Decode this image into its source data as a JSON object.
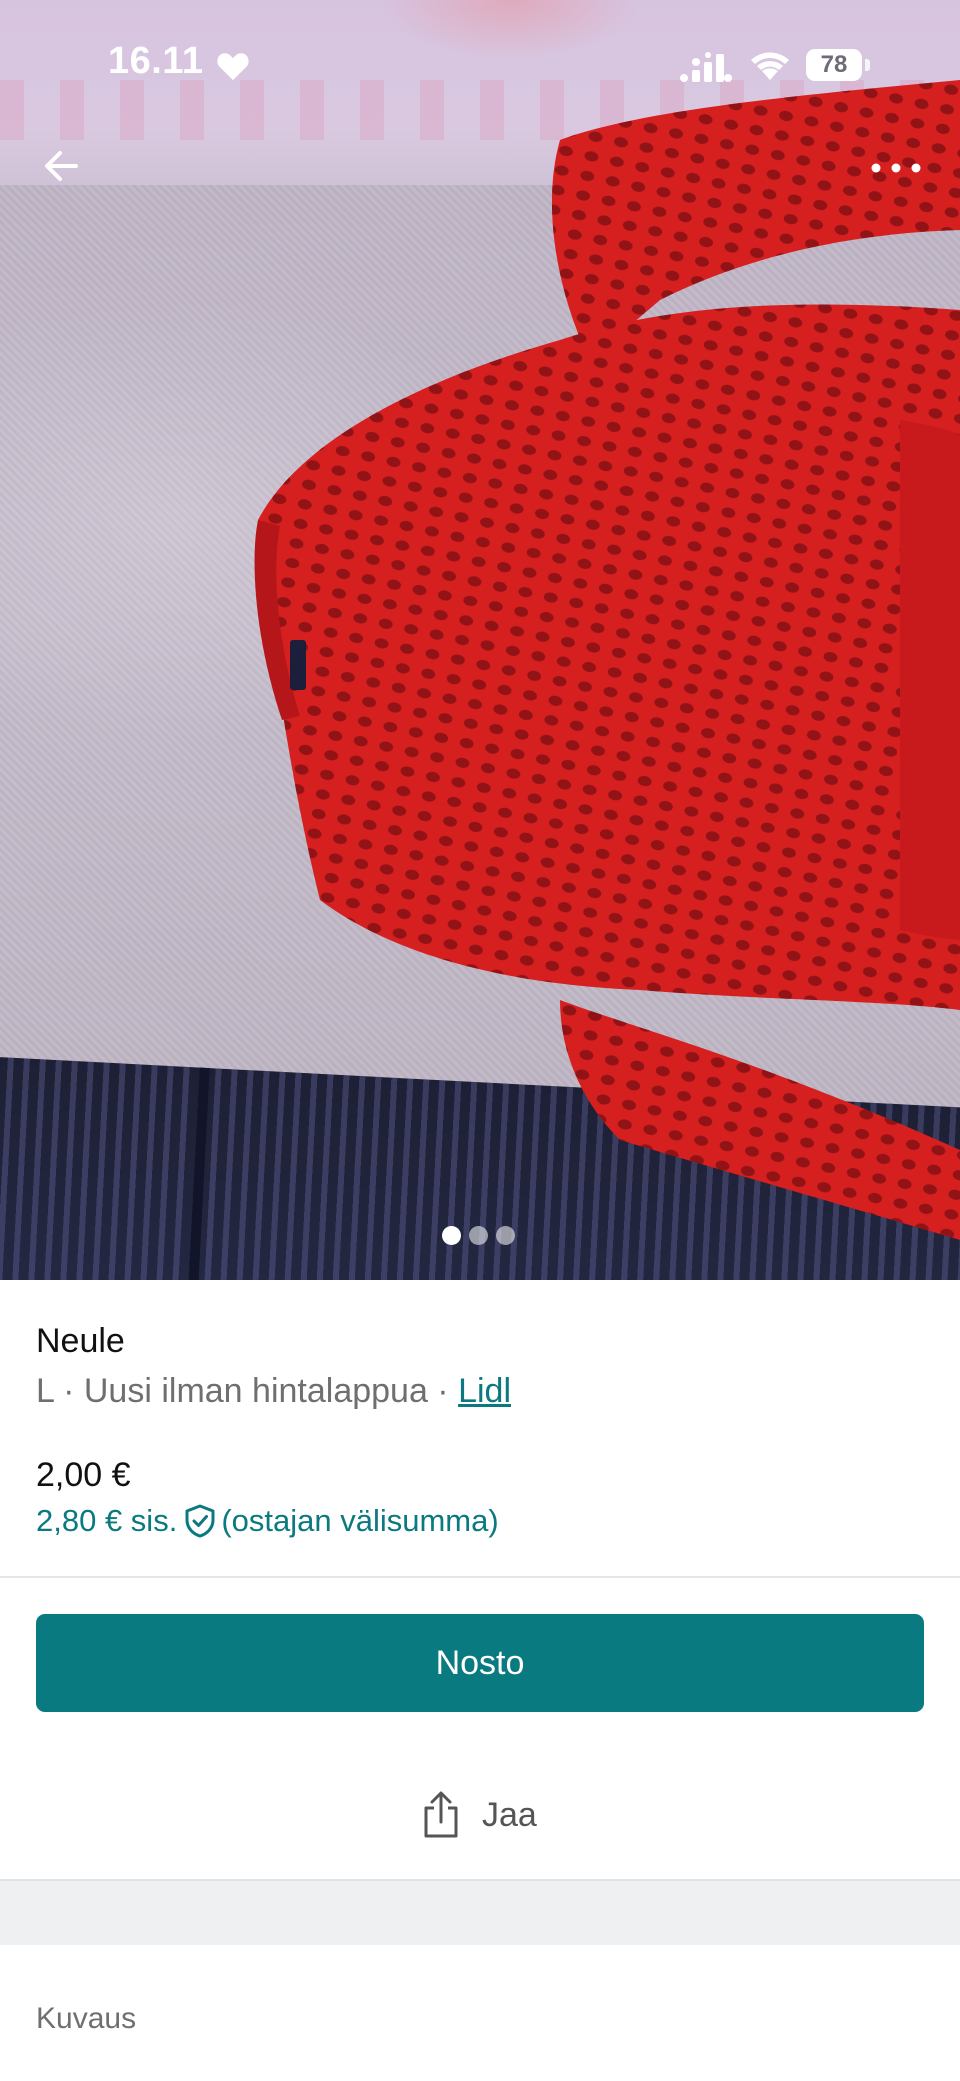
{
  "status_bar": {
    "time": "16.11",
    "battery": "78",
    "icons": [
      "heart-icon",
      "signal-icon",
      "wifi-icon",
      "battery-icon"
    ]
  },
  "navigation": {
    "back_icon": "arrow-left-icon",
    "more_icon": "more-horizontal-icon"
  },
  "gallery": {
    "image_count": 3,
    "active_index": 0
  },
  "item": {
    "title": "Neule",
    "size": "L",
    "separator": " · ",
    "condition": "Uusi ilman hintalappua",
    "brand": "Lidl",
    "price": "2,00 €",
    "price_incl_prefix": "2,80 € sis.",
    "price_incl_suffix": "(ostajan välisumma)"
  },
  "actions": {
    "buy_label": "Nosto",
    "share_label": "Jaa"
  },
  "sections": {
    "description_label": "Kuvaus"
  },
  "colors": {
    "accent": "#097a80",
    "link": "#0a7a80",
    "secondary_text": "#6f6f6f",
    "photo_garment": "#d61f1f"
  }
}
